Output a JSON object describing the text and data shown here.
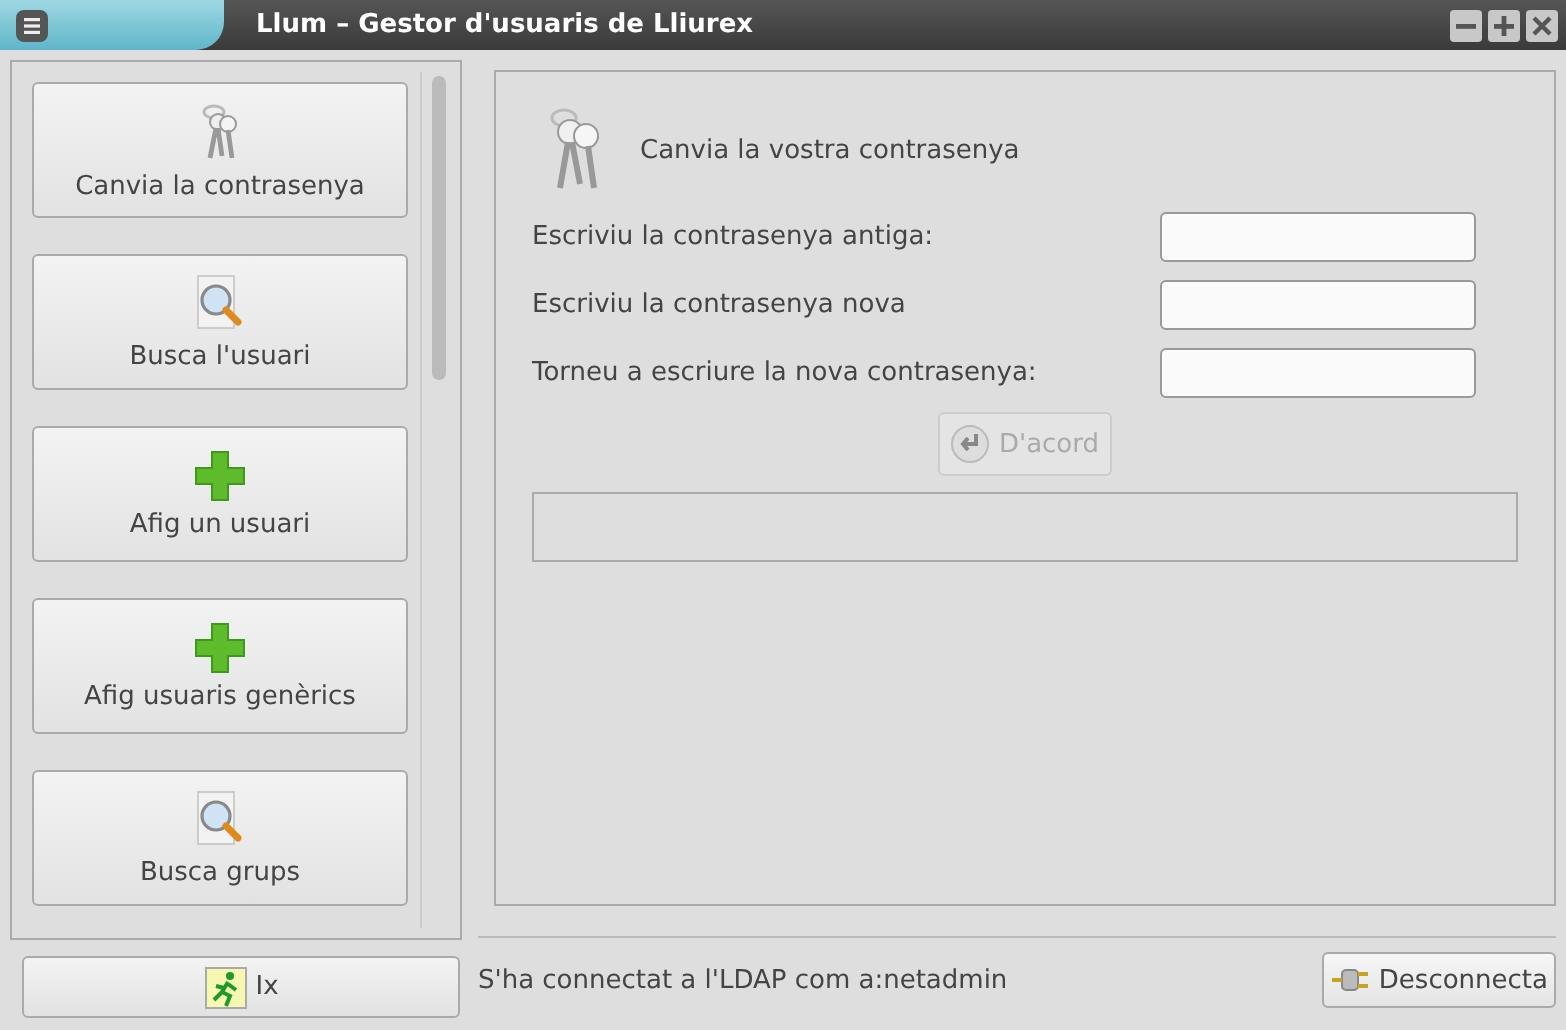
{
  "window": {
    "title": "Llum – Gestor d'usuaris de Lliurex"
  },
  "sidebar": {
    "items": [
      {
        "label": "Canvia la contrasenya",
        "kind": "keys",
        "selected": false
      },
      {
        "label": "Busca l'usuari",
        "kind": "search",
        "selected": false
      },
      {
        "label": "Afig un usuari",
        "kind": "add",
        "selected": false
      },
      {
        "label": "Afig usuaris genèrics",
        "kind": "add",
        "selected": false
      },
      {
        "label": "Busca grups",
        "kind": "search",
        "selected": false
      }
    ],
    "exit_button": "Ix"
  },
  "form": {
    "heading": "Canvia la vostra contrasenya",
    "fields": [
      {
        "label": "Escriviu la contrasenya antiga:"
      },
      {
        "label": "Escriviu la contrasenya nova"
      },
      {
        "label": "Torneu a escriure la nova contrasenya:"
      }
    ],
    "ok_button": {
      "label": "D'acord",
      "disabled": true
    }
  },
  "status_bar": {
    "message": "S'ha connectat a l'LDAP com a:netadmin",
    "disconnect_button": "Desconnecta"
  }
}
